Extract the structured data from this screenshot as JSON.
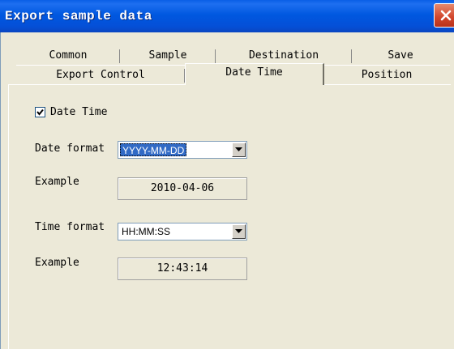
{
  "window": {
    "title": "Export sample data"
  },
  "tabs_row1": [
    "Common",
    "Sample",
    "Destination",
    "Save"
  ],
  "tabs_row2": [
    "Export Control",
    "Date Time",
    "Position"
  ],
  "active_tab": "Date Time",
  "date_time_checkbox": {
    "label": "Date Time",
    "checked": true
  },
  "date_format": {
    "label": "Date format",
    "value": "YYYY-MM-DD"
  },
  "date_example": {
    "label": "Example",
    "value": "2010-04-06"
  },
  "time_format": {
    "label": "Time format",
    "value": "HH:MM:SS"
  },
  "time_example": {
    "label": "Example",
    "value": "12:43:14"
  },
  "icons": {
    "close": "close-icon",
    "check": "check-icon",
    "dropdown": "chevron-down-icon"
  },
  "colors": {
    "titlebar": "#0058E0",
    "selection": "#316AC5",
    "face": "#ECE9D8",
    "close": "#D1452B"
  }
}
